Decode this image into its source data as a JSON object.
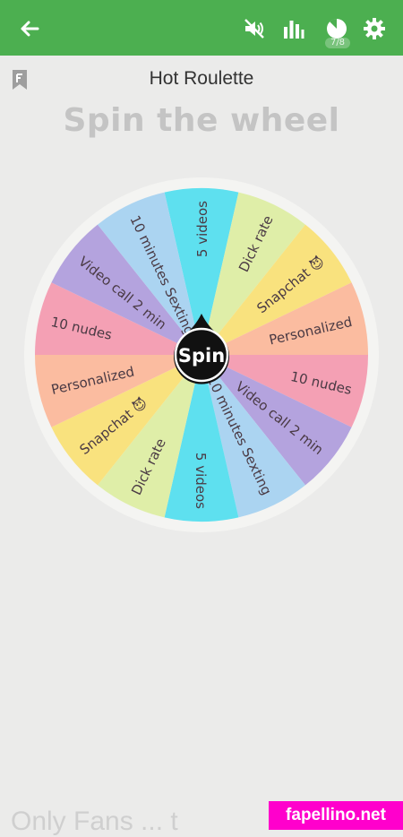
{
  "header": {
    "back_icon": "arrow-left-icon",
    "icons": [
      "volume-off-icon",
      "bar-chart-icon",
      "pie-progress-icon",
      "gear-icon"
    ],
    "progress": "7/8",
    "accent": "#4caf50"
  },
  "page": {
    "title": "Hot Roulette",
    "headline": "Spin the wheel",
    "bookmark_icon": "bookmark-f-icon"
  },
  "wheel": {
    "center_label": "Spin",
    "segments": [
      {
        "label": "5 videos",
        "color": "#5ee0ef"
      },
      {
        "label": "Dick rate",
        "color": "#dfeea8"
      },
      {
        "label": "Snapchat 😈",
        "color": "#f9e27e"
      },
      {
        "label": "Personalized",
        "color": "#fbbca0"
      },
      {
        "label": "10 nudes",
        "color": "#f4a0b4"
      },
      {
        "label": "Video call 2 min",
        "color": "#b4a3de"
      },
      {
        "label": "10 minutes Sexting",
        "color": "#abd4f1"
      },
      {
        "label": "5 videos",
        "color": "#5ee0ef"
      },
      {
        "label": "Dick rate",
        "color": "#dfeea8"
      },
      {
        "label": "Snapchat 😈",
        "color": "#f9e27e"
      },
      {
        "label": "Personalized",
        "color": "#fbbca0"
      },
      {
        "label": "10 nudes",
        "color": "#f4a0b4"
      },
      {
        "label": "Video call 2 min",
        "color": "#b4a3de"
      },
      {
        "label": "10 minutes Sexting",
        "color": "#abd4f1"
      }
    ]
  },
  "footer": {
    "cut_text": "Only Fans  ...  t"
  },
  "watermark": "fapellino.net"
}
